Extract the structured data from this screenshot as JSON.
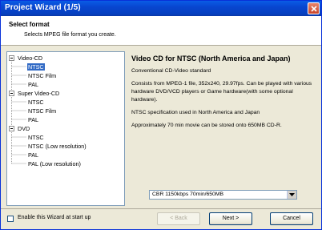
{
  "window": {
    "title": "Project Wizard (1/5)"
  },
  "header": {
    "title": "Select format",
    "subtitle": "Selects MPEG file format you create."
  },
  "tree": [
    {
      "label": "Video-CD",
      "level": 0,
      "expander": true
    },
    {
      "label": "NTSC",
      "level": 1,
      "selected": true
    },
    {
      "label": "NTSC Film",
      "level": 1
    },
    {
      "label": "PAL",
      "level": 1
    },
    {
      "label": "Super Video-CD",
      "level": 0,
      "expander": true
    },
    {
      "label": "NTSC",
      "level": 1
    },
    {
      "label": "NTSC Film",
      "level": 1
    },
    {
      "label": "PAL",
      "level": 1
    },
    {
      "label": "DVD",
      "level": 0,
      "expander": true
    },
    {
      "label": "NTSC",
      "level": 1
    },
    {
      "label": "NTSC (Low resolution)",
      "level": 1
    },
    {
      "label": "PAL",
      "level": 1
    },
    {
      "label": "PAL (Low resolution)",
      "level": 1
    }
  ],
  "description": {
    "title": "Video CD for NTSC (North America and Japan)",
    "lines": [
      "Conventional CD-Video standard",
      "Consists from MPEG-1 file, 352x240, 29.97fps. Can be played with various hardware DVD/VCD players or Game hardware(with some optional hardware).",
      "NTSC specification used in North America and Japan",
      "Approximately 70 min movie can be stored onto 650MB CD-R."
    ]
  },
  "bitrate_select": {
    "value": "CBR 1150kbps   70min/650MB"
  },
  "footer": {
    "checkbox_label": "Enable this Wizard at start up",
    "back_label": "< Back",
    "next_label": "Next >",
    "cancel_label": "Cancel"
  }
}
